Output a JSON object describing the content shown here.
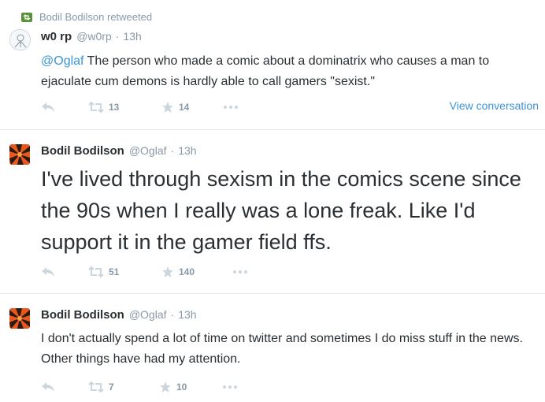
{
  "tweets": [
    {
      "retweet_context": "Bodil Bodilson retweeted",
      "fullname": "w0 rp",
      "handle": "@w0rp",
      "dot": "·",
      "time": "13h",
      "mention": "@Oglaf",
      "text_rest": " The person who made a comic about a dominatrix who causes a man to ejaculate cum demons is hardly able to call gamers \"sexist.\"",
      "retweets": "13",
      "favorites": "14",
      "view_conversation": "View conversation"
    },
    {
      "fullname": "Bodil Bodilson",
      "handle": "@Oglaf",
      "dot": "·",
      "time": "13h",
      "text": "I've lived through sexism in the comics scene since the 90s when I really was a lone freak. Like I'd support it in the gamer field ffs.",
      "retweets": "51",
      "favorites": "140"
    },
    {
      "fullname": "Bodil Bodilson",
      "handle": "@Oglaf",
      "dot": "·",
      "time": "13h",
      "text": "I don't actually spend a lot of time on twitter and sometimes I do miss stuff in the news. Other things have had my attention.",
      "retweets": "7",
      "favorites": "10"
    }
  ],
  "colors": {
    "link": "#3b94d9",
    "muted": "#8899a6",
    "text": "#292f33",
    "divider": "#e1e8ed",
    "retweet_badge": "#5c913b"
  },
  "icons": {
    "reply": "reply-icon",
    "retweet": "retweet-icon",
    "favorite": "star-icon",
    "more": "more-dots-icon"
  }
}
